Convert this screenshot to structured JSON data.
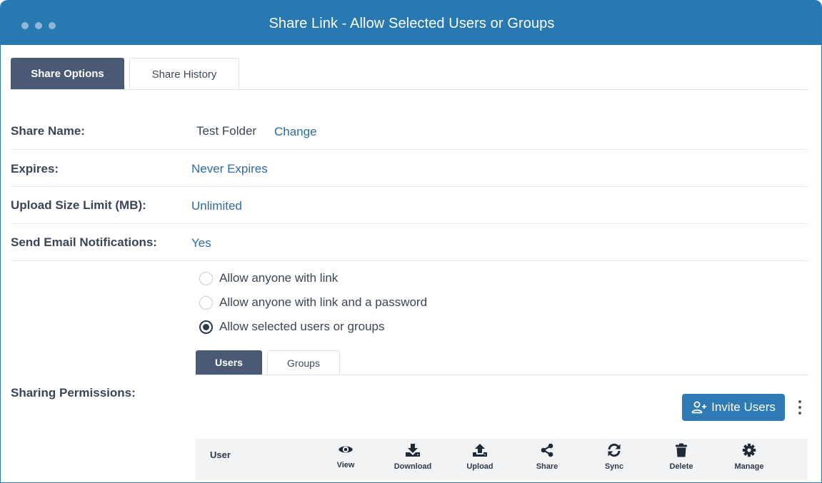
{
  "window": {
    "title": "Share Link - Allow Selected Users or Groups"
  },
  "tabs": [
    {
      "label": "Share Options",
      "active": true
    },
    {
      "label": "Share History",
      "active": false
    }
  ],
  "share_name": {
    "label": "Share Name:",
    "value": "Test Folder",
    "change_link": "Change"
  },
  "expires": {
    "label": "Expires:",
    "value": "Never Expires"
  },
  "upload_limit": {
    "label": "Upload Size Limit (MB):",
    "value": "Unlimited"
  },
  "email_notifications": {
    "label": "Send Email Notifications:",
    "value": "Yes"
  },
  "sharing_permissions": {
    "label": "Sharing Permissions:",
    "options": [
      {
        "label": "Allow anyone with link",
        "selected": false
      },
      {
        "label": "Allow anyone with link and a password",
        "selected": false
      },
      {
        "label": "Allow selected users or groups",
        "selected": true
      }
    ],
    "subtabs": [
      {
        "label": "Users",
        "active": true
      },
      {
        "label": "Groups",
        "active": false
      }
    ],
    "invite_button": "Invite Users",
    "table": {
      "user_header": "User",
      "columns": [
        {
          "label": "View",
          "icon": "eye-icon"
        },
        {
          "label": "Download",
          "icon": "download-icon"
        },
        {
          "label": "Upload",
          "icon": "upload-icon"
        },
        {
          "label": "Share",
          "icon": "share-icon"
        },
        {
          "label": "Sync",
          "icon": "sync-icon"
        },
        {
          "label": "Delete",
          "icon": "trash-icon"
        },
        {
          "label": "Manage",
          "icon": "gear-icon"
        }
      ]
    }
  },
  "colors": {
    "titlebar": "#2878b1",
    "active_tab": "#4a5a74",
    "link": "#2c6aa6",
    "primary_button": "#2d7ab5"
  }
}
